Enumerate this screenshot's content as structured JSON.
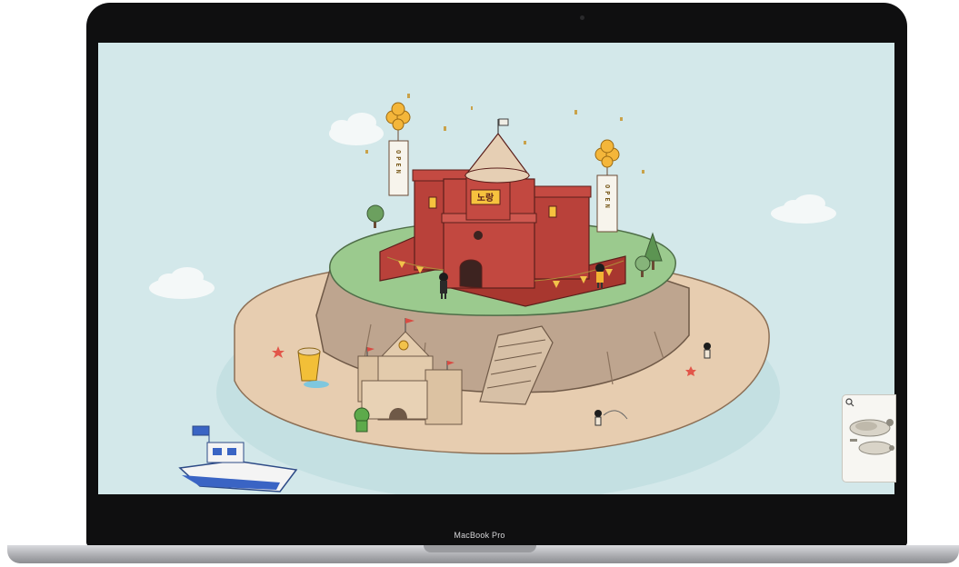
{
  "device": {
    "model_label": "MacBook Pro"
  },
  "scene": {
    "banners": [
      {
        "id": "left",
        "text": "OPEN"
      },
      {
        "id": "right",
        "text": "OPEN"
      }
    ],
    "castle_sign": "노랑",
    "boat_flag_icon": "flag-icon"
  },
  "minimap": {
    "search_icon": "search-icon"
  },
  "colors": {
    "sky": "#d3e8ea",
    "sand": "#e7cdb0",
    "grass": "#9bca8e",
    "brick": "#b9413a",
    "roof": "#e6cfb4",
    "balloon": "#f4b63a"
  }
}
